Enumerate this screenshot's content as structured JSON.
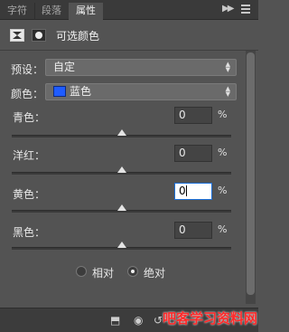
{
  "tabs": [
    {
      "label": "字符"
    },
    {
      "label": "段落"
    },
    {
      "label": "属性"
    }
  ],
  "header": {
    "title": "可选颜色"
  },
  "preset": {
    "label": "预设：",
    "value": "自定"
  },
  "colors": {
    "label": "颜色：",
    "value": "蓝色",
    "swatch": "#1f5cff"
  },
  "sliders": [
    {
      "label": "青色：",
      "value": "0",
      "unit": "%"
    },
    {
      "label": "洋红：",
      "value": "0",
      "unit": "%"
    },
    {
      "label": "黄色：",
      "value": "0",
      "unit": "%"
    },
    {
      "label": "黑色：",
      "value": "0",
      "unit": "%"
    }
  ],
  "method": {
    "relative_label": "相对",
    "absolute_label": "绝对",
    "selected": "absolute"
  },
  "watermark": "吧客学习资料网",
  "icons": {
    "tab_expand": "double-chevron-right-icon",
    "tab_menu": "menu-icon",
    "footer": [
      "clip-to-layer-icon",
      "visibility-eye-icon",
      "reset-icon",
      "toggle-visibility-icon",
      "delete-icon"
    ]
  }
}
